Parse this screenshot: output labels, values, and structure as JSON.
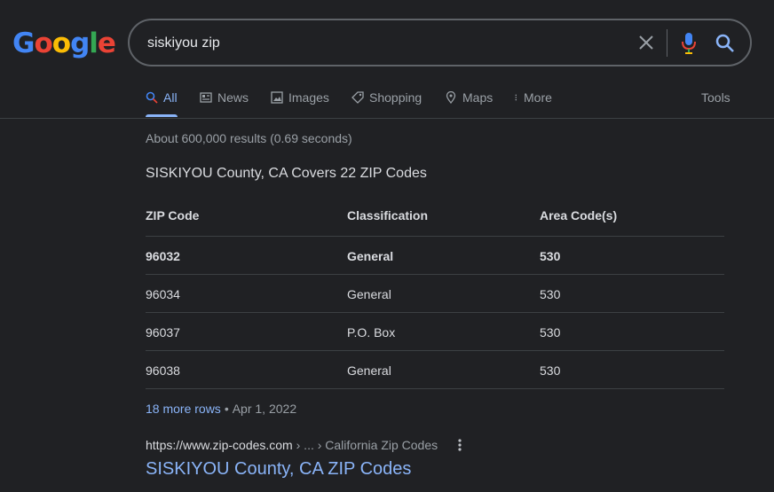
{
  "logo": {
    "letters": [
      "G",
      "o",
      "o",
      "g",
      "l",
      "e"
    ]
  },
  "search": {
    "query": "siskiyou zip"
  },
  "tabs": [
    {
      "label": "All",
      "icon": "search-icon",
      "active": true
    },
    {
      "label": "News",
      "icon": "news-icon"
    },
    {
      "label": "Images",
      "icon": "image-icon"
    },
    {
      "label": "Shopping",
      "icon": "tag-icon"
    },
    {
      "label": "Maps",
      "icon": "map-pin-icon"
    },
    {
      "label": "More",
      "icon": "more-vert-icon"
    }
  ],
  "tools_label": "Tools",
  "result_stats": "About 600,000 results (0.69 seconds)",
  "snippet": {
    "title": "SISKIYOU County, CA Covers 22 ZIP Codes",
    "columns": [
      "ZIP Code",
      "Classification",
      "Area Code(s)"
    ],
    "rows": [
      [
        "96032",
        "General",
        "530"
      ],
      [
        "96034",
        "General",
        "530"
      ],
      [
        "96037",
        "P.O. Box",
        "530"
      ],
      [
        "96038",
        "General",
        "530"
      ]
    ],
    "more_rows": "18 more rows",
    "date": "Apr 1, 2022"
  },
  "result": {
    "site": "https://www.zip-codes.com",
    "breadcrumb": " › ... › California Zip Codes",
    "title": "SISKIYOU County, CA ZIP Codes"
  },
  "colors": {
    "background": "#202124",
    "link": "#8ab4f8",
    "text": "#dadce0",
    "muted": "#9aa0a6"
  }
}
